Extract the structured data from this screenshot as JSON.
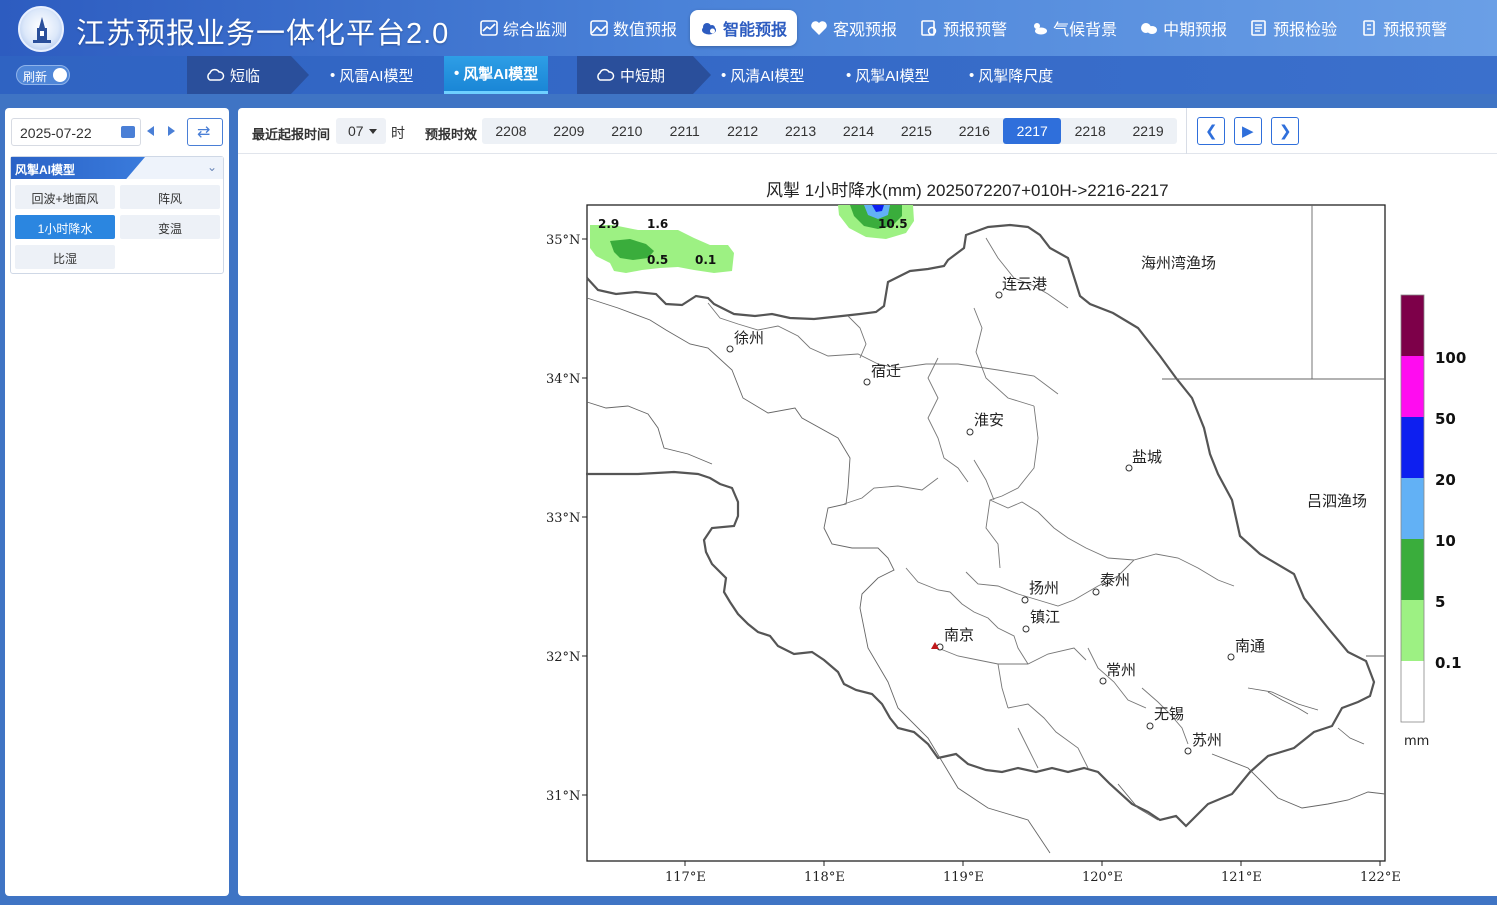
{
  "header": {
    "title": "江苏预报业务一体化平台2.0",
    "nav": [
      {
        "label": "综合监测",
        "icon": "chart-icon"
      },
      {
        "label": "数值预报",
        "icon": "image-icon"
      },
      {
        "label": "智能预报",
        "icon": "cloud-icon",
        "active": true
      },
      {
        "label": "客观预报",
        "icon": "heart-icon"
      },
      {
        "label": "预报预警",
        "icon": "alert-doc-icon"
      },
      {
        "label": "气候背景",
        "icon": "sun-cloud-icon"
      },
      {
        "label": "中期预报",
        "icon": "weather-icon"
      },
      {
        "label": "预报检验",
        "icon": "checklist-icon"
      },
      {
        "label": "预报预警",
        "icon": "warning-icon"
      }
    ]
  },
  "subnav": {
    "refresh_label": "刷新",
    "groups": [
      {
        "label": "短临",
        "items": [
          "风雷AI模型",
          "风掣AI模型"
        ]
      },
      {
        "label": "中短期",
        "items": [
          "风清AI模型",
          "风掣AI模型",
          "风掣降尺度"
        ]
      }
    ],
    "active_item": "风掣AI模型"
  },
  "sidebar": {
    "date": "2025-07-22",
    "model_title": "风掣AI模型",
    "variables": [
      "回波+地面风",
      "阵风",
      "1小时降水",
      "变温",
      "比湿"
    ],
    "active_variable": "1小时降水"
  },
  "toolbar": {
    "latest_label": "最近起报时间",
    "hour": "07",
    "hour_unit": "时",
    "valid_label": "预报时效",
    "valid_times": [
      "2208",
      "2209",
      "2210",
      "2211",
      "2212",
      "2213",
      "2214",
      "2215",
      "2216",
      "2217",
      "2218",
      "2219"
    ],
    "active_time": "2217"
  },
  "map": {
    "title": "风掣  1小时降水(mm) 2025072207+010H->2216-2217",
    "lat_labels": [
      "35°N",
      "34°N",
      "33°N",
      "32°N",
      "31°N"
    ],
    "lon_labels": [
      "117°E",
      "118°E",
      "119°E",
      "120°E",
      "121°E",
      "122°E"
    ],
    "cities": [
      "连云港",
      "徐州",
      "宿迁",
      "淮安",
      "盐城",
      "扬州",
      "泰州",
      "镇江",
      "南京",
      "南通",
      "常州",
      "无锡",
      "苏州"
    ],
    "sea_areas": [
      "海州湾渔场",
      "吕泗渔场"
    ],
    "rain_labels": [
      "2.9",
      "1.6",
      "0.5",
      "0.1",
      "10.5"
    ],
    "colorbar": {
      "labels": [
        "100",
        "50",
        "20",
        "10",
        "5",
        "0.1"
      ],
      "unit": "mm",
      "colors": [
        "#7d0049",
        "#ff0cf0",
        "#0d1ff0",
        "#62b1f5",
        "#3aad3c",
        "#9df183",
        "#ffffff"
      ]
    }
  }
}
